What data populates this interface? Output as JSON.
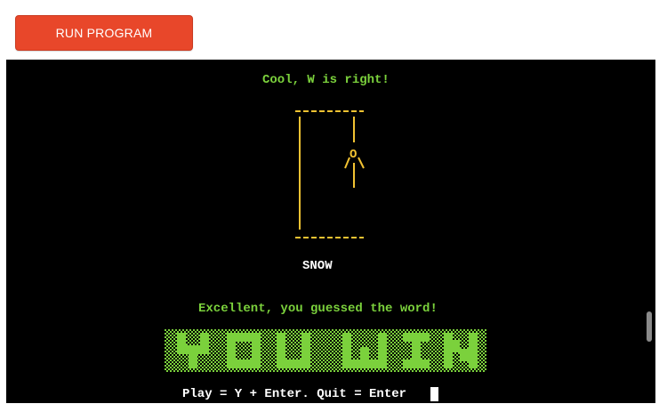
{
  "toolbar": {
    "run_label": "RUN PROGRAM",
    "accent_color": "#e8472a"
  },
  "terminal": {
    "feedback": "Cool, W is right!",
    "revealed_word": "SNOW",
    "win_message": "Excellent, you guessed the word!",
    "banner_text": "YOU WIN",
    "prompt": "Play = Y + Enter. Quit = Enter",
    "text_color": "#7bd13c",
    "art_color": "#f1c232",
    "background": "#000000"
  }
}
